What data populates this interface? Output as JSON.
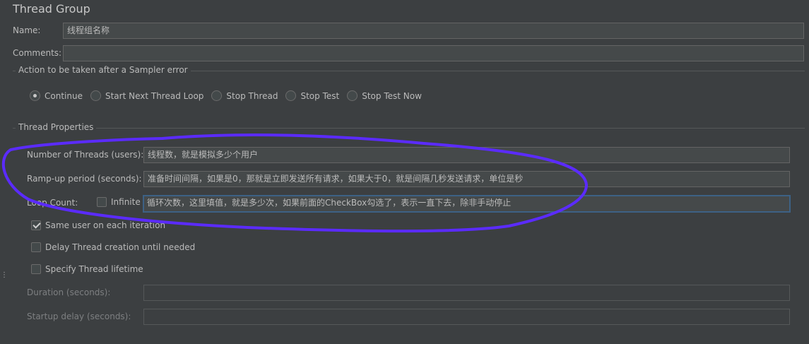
{
  "title": "Thread Group",
  "name": {
    "label": "Name:",
    "value": "线程组名称"
  },
  "comments": {
    "label": "Comments:",
    "value": ""
  },
  "sampler_error": {
    "title": "Action to be taken after a Sampler error",
    "options": [
      "Continue",
      "Start Next Thread Loop",
      "Stop Thread",
      "Stop Test",
      "Stop Test Now"
    ],
    "selected": "Continue"
  },
  "thread_props": {
    "title": "Thread Properties",
    "threads_label": "Number of Threads (users):",
    "threads_value": "线程数，就是模拟多少个用户",
    "rampup_label": "Ramp-up period (seconds):",
    "rampup_value": "准备时间间隔，如果是0，那就是立即发送所有请求，如果大于0，就是间隔几秒发送请求，单位是秒",
    "loop_label": "Loop Count:",
    "infinite_label": "Infinite",
    "infinite_checked": false,
    "loop_value": "循环次数，这里填值，就是多少次，如果前面的CheckBox勾选了，表示一直下去，除非手动停止",
    "same_user_label": "Same user on each iteration",
    "same_user_checked": true,
    "delay_label": "Delay Thread creation until needed",
    "delay_checked": false,
    "lifetime_label": "Specify Thread lifetime",
    "lifetime_checked": false,
    "duration_label": "Duration (seconds):",
    "duration_value": "",
    "startup_label": "Startup delay (seconds):",
    "startup_value": ""
  },
  "colors": {
    "background": "#3c3f41",
    "annotation": "#5b2bff",
    "focus_border": "#3d6185"
  }
}
